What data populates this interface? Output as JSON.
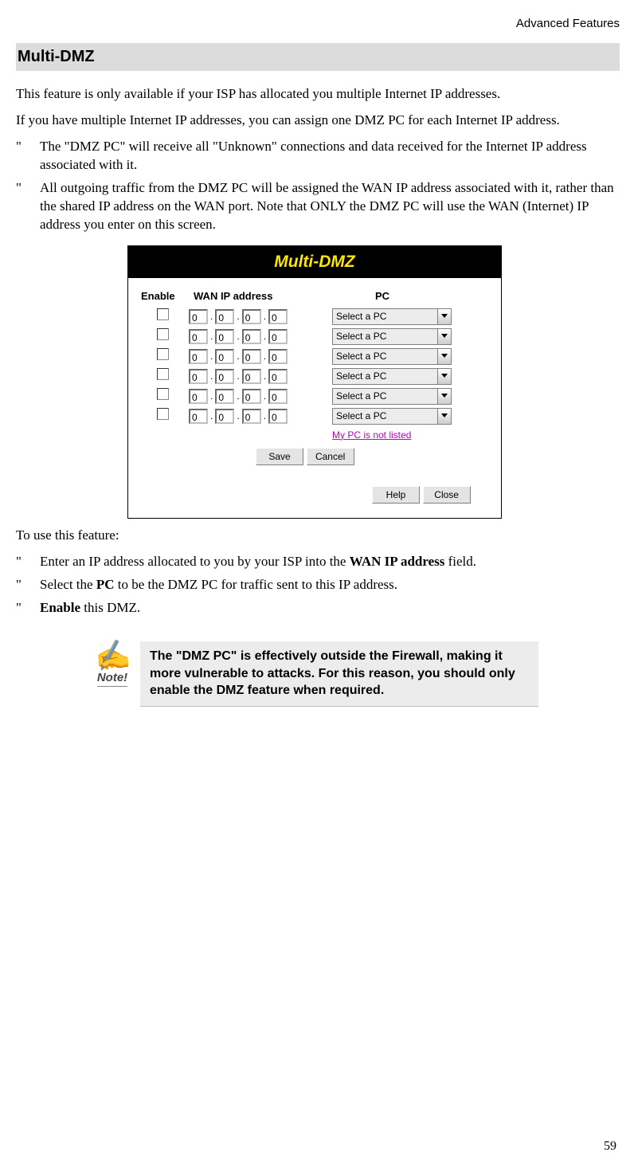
{
  "header": {
    "section": "Advanced Features"
  },
  "title": "Multi-DMZ",
  "para1": "This feature is only available if your ISP has allocated you multiple Internet IP addresses.",
  "para2": "If you have multiple Internet IP addresses, you can assign one DMZ PC for each Internet IP address.",
  "list1": {
    "marker": "\"",
    "items": [
      "The \"DMZ PC\" will receive all \"Unknown\" connections and data received for the Internet IP address associated with it.",
      "All outgoing traffic from the DMZ PC will be assigned the WAN IP address associated with it, rather than the shared IP address on the WAN port. Note that ONLY the DMZ PC will use the WAN (Internet) IP address you enter on this screen."
    ]
  },
  "dialog": {
    "title": "Multi-DMZ",
    "cols": {
      "enable": "Enable",
      "wan": "WAN IP address",
      "pc": "PC"
    },
    "rows": [
      {
        "ip": [
          "0",
          "0",
          "0",
          "0"
        ],
        "pc": "Select a PC"
      },
      {
        "ip": [
          "0",
          "0",
          "0",
          "0"
        ],
        "pc": "Select a PC"
      },
      {
        "ip": [
          "0",
          "0",
          "0",
          "0"
        ],
        "pc": "Select a PC"
      },
      {
        "ip": [
          "0",
          "0",
          "0",
          "0"
        ],
        "pc": "Select a PC"
      },
      {
        "ip": [
          "0",
          "0",
          "0",
          "0"
        ],
        "pc": "Select a PC"
      },
      {
        "ip": [
          "0",
          "0",
          "0",
          "0"
        ],
        "pc": "Select a PC"
      }
    ],
    "link": "My PC is not listed",
    "buttons": {
      "save": "Save",
      "cancel": "Cancel",
      "help": "Help",
      "close": "Close"
    }
  },
  "para3": "To use this feature:",
  "list2": {
    "marker": "\"",
    "items": [
      {
        "pre": "Enter an IP address allocated to you by your ISP into the ",
        "bold": "WAN IP address",
        "post": " field."
      },
      {
        "pre": "Select the ",
        "bold": "PC",
        "post": " to be the DMZ PC for traffic sent to this IP address."
      },
      {
        "pre": "",
        "bold": "Enable",
        "post": " this DMZ."
      }
    ]
  },
  "note": {
    "label": "Note!",
    "text": "The \"DMZ PC\" is effectively outside the Firewall, making it more vulnerable to attacks. For this reason, you should only enable the DMZ feature when required."
  },
  "page": "59"
}
